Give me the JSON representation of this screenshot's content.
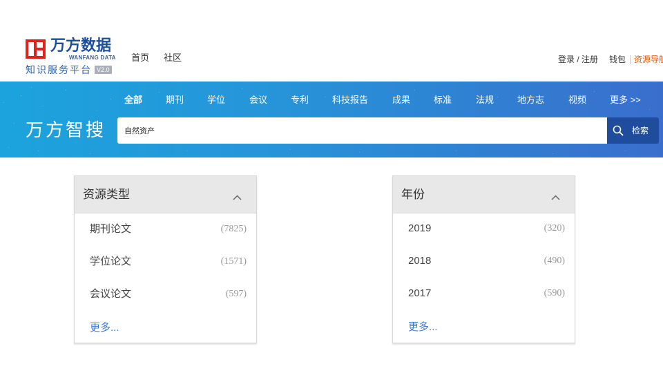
{
  "header": {
    "logo": {
      "icon": "wanfang-logo-icon",
      "brand_cn": "万方数据",
      "brand_en": "WANFANG DATA",
      "platform": "知识服务平台",
      "version": "V2.0"
    },
    "nav": [
      {
        "label": "首页"
      },
      {
        "label": "社区"
      }
    ],
    "user_links": {
      "login": "登录 / 注册",
      "wallet": "钱包",
      "resource_nav": "资源导航"
    }
  },
  "search": {
    "brand": "万方智搜",
    "tabs": [
      {
        "label": "全部",
        "active": true
      },
      {
        "label": "期刊",
        "active": false
      },
      {
        "label": "学位",
        "active": false
      },
      {
        "label": "会议",
        "active": false
      },
      {
        "label": "专利",
        "active": false
      },
      {
        "label": "科技报告",
        "active": false
      },
      {
        "label": "成果",
        "active": false
      },
      {
        "label": "标准",
        "active": false
      },
      {
        "label": "法规",
        "active": false
      },
      {
        "label": "地方志",
        "active": false
      },
      {
        "label": "视频",
        "active": false
      },
      {
        "label": "更多 >>",
        "active": false
      }
    ],
    "query": "自然资产",
    "button": {
      "label": "检索",
      "icon": "search-icon"
    }
  },
  "facets": [
    {
      "title": "资源类型",
      "toggle_icon": "chevron-up-icon",
      "items": [
        {
          "label": "期刊论文",
          "count": "(7825)"
        },
        {
          "label": "学位论文",
          "count": "(1571)"
        },
        {
          "label": "会议论文",
          "count": "(597)"
        }
      ],
      "more": "更多..."
    },
    {
      "title": "年份",
      "toggle_icon": "chevron-up-icon",
      "items": [
        {
          "label": "2019",
          "count": "(320)"
        },
        {
          "label": "2018",
          "count": "(490)"
        },
        {
          "label": "2017",
          "count": "(590)"
        }
      ],
      "more": "更多..."
    }
  ],
  "colors": {
    "brand_blue": "#1b4e9f",
    "banner_start": "#1ca3dd",
    "banner_end": "#3a6ecd",
    "search_button": "#1f4c9c",
    "link_blue": "#3b7bd4",
    "resource_nav_orange": "#e35d0a",
    "facet_header_bg": "#e8e8e8"
  }
}
